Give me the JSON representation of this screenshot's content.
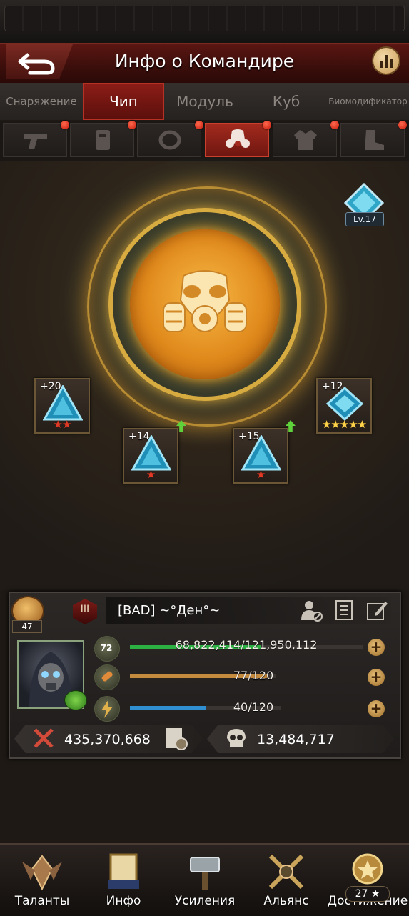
{
  "header": {
    "title": "Инфо о Командире",
    "back_icon": "back-arrow-icon",
    "stats_icon": "bar-chart-icon"
  },
  "category_tabs": [
    {
      "label": "Снаряжение",
      "active": false
    },
    {
      "label": "Чип",
      "active": true
    },
    {
      "label": "Модуль",
      "active": false
    },
    {
      "label": "Куб",
      "active": false
    },
    {
      "label": "Биомодификатор",
      "active": false
    }
  ],
  "gear_slots": [
    {
      "icon": "pistol-icon",
      "active": false,
      "notify": true
    },
    {
      "icon": "armor-plate-icon",
      "active": false,
      "notify": true
    },
    {
      "icon": "ring-icon",
      "active": false,
      "notify": true
    },
    {
      "icon": "gas-mask-icon",
      "active": true,
      "notify": true
    },
    {
      "icon": "jacket-icon",
      "active": false,
      "notify": true
    },
    {
      "icon": "boot-icon",
      "active": false,
      "notify": true
    }
  ],
  "chip": {
    "center_icon": "gas-mask-icon",
    "level": "Lv.17"
  },
  "modules": [
    {
      "bonus": "+20",
      "stars": 2,
      "star_color": "red",
      "upgrade": false
    },
    {
      "bonus": "+14",
      "stars": 1,
      "star_color": "red",
      "upgrade": true
    },
    {
      "bonus": "+15",
      "stars": 1,
      "star_color": "red",
      "upgrade": true
    },
    {
      "bonus": "+12",
      "stars": 5,
      "star_color": "gold",
      "upgrade": false
    }
  ],
  "commander": {
    "rank_level": "47",
    "alliance_emblem": "III",
    "name": "[BAD]   ~°Ден°~",
    "level": "72",
    "exp": {
      "text": "68,822,414/121,950,112",
      "fraction": 0.564,
      "color": "#2db043"
    },
    "stamina": {
      "text": "77/120",
      "fraction": 0.95,
      "color": "#c48a3e"
    },
    "energy": {
      "text": "40/120",
      "fraction": 0.5,
      "color": "#2f8fd0"
    },
    "power": "435,370,668",
    "kills": "13,484,717"
  },
  "bottom_nav": [
    {
      "label": "Таланты"
    },
    {
      "label": "Инфо"
    },
    {
      "label": "Усиления"
    },
    {
      "label": "Альянс"
    },
    {
      "label": "Достижение",
      "badge": "27 ★"
    }
  ]
}
